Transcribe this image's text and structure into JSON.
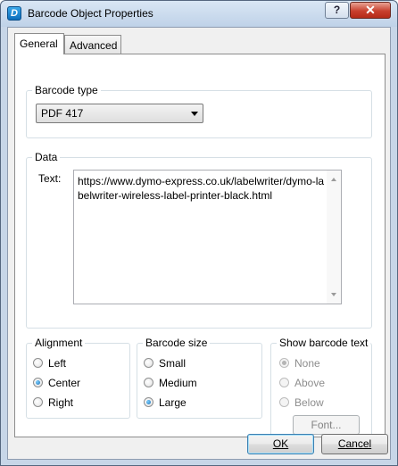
{
  "window": {
    "title": "Barcode Object Properties",
    "app_icon_glyph": "D",
    "help_label": "?",
    "close_label": "✕"
  },
  "tabs": [
    {
      "label": "General",
      "active": true
    },
    {
      "label": "Advanced",
      "active": false
    }
  ],
  "barcode_type": {
    "group_label": "Barcode type",
    "selected": "PDF 417"
  },
  "data": {
    "group_label": "Data",
    "text_label": "Text:",
    "text_value": "https://www.dymo-express.co.uk/labelwriter/dymo-labelwriter-wireless-label-printer-black.html"
  },
  "alignment": {
    "group_label": "Alignment",
    "options": [
      {
        "label": "Left",
        "checked": false
      },
      {
        "label": "Center",
        "checked": true
      },
      {
        "label": "Right",
        "checked": false
      }
    ]
  },
  "barcode_size": {
    "group_label": "Barcode size",
    "options": [
      {
        "label": "Small",
        "checked": false
      },
      {
        "label": "Medium",
        "checked": false
      },
      {
        "label": "Large",
        "checked": true
      }
    ]
  },
  "show_text": {
    "group_label": "Show barcode text",
    "options": [
      {
        "label": "None",
        "checked": true
      },
      {
        "label": "Above",
        "checked": false
      },
      {
        "label": "Below",
        "checked": false
      }
    ],
    "font_button": "Font..."
  },
  "buttons": {
    "ok": "OK",
    "cancel": "Cancel"
  }
}
